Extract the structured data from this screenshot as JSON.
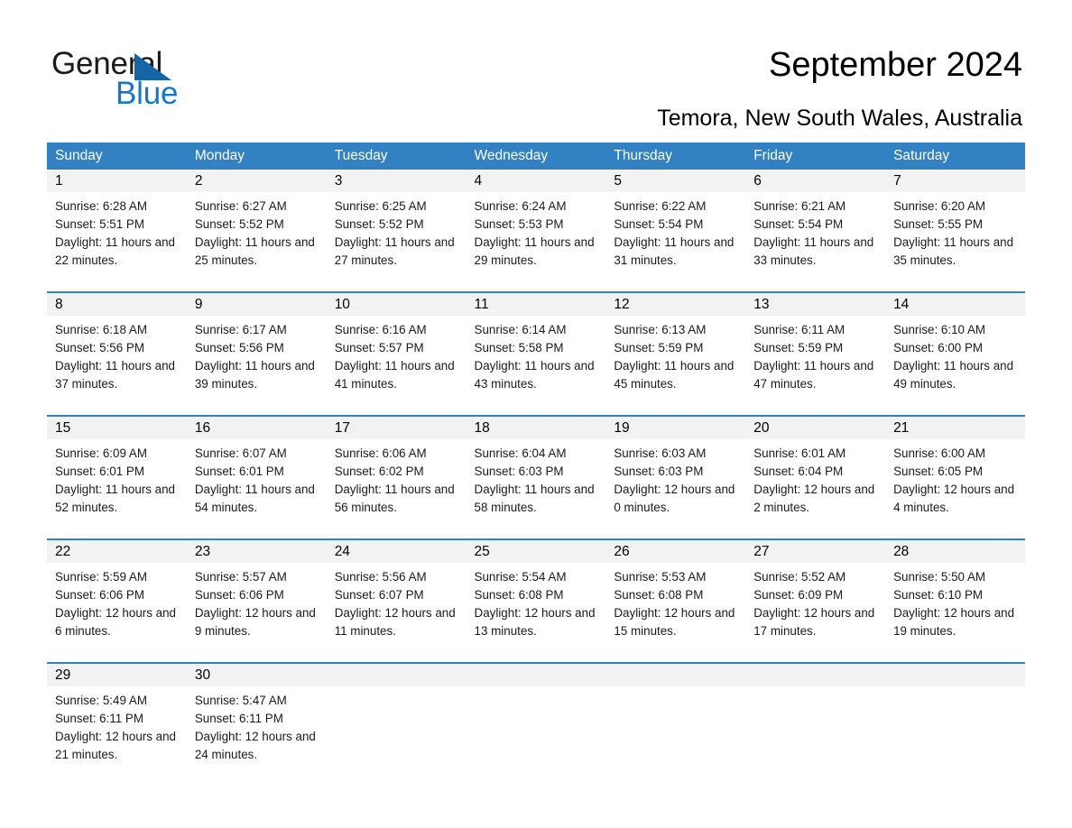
{
  "brand": {
    "name_part1": "General",
    "name_part2": "Blue",
    "triangle_color": "#1565a8",
    "blue_color": "#1577cc"
  },
  "header": {
    "title": "September 2024",
    "location": "Temora, New South Wales, Australia"
  },
  "calendar": {
    "accent_color": "#3281c3",
    "daynum_band_color": "#f2f2f2",
    "weekday_headers": [
      "Sunday",
      "Monday",
      "Tuesday",
      "Wednesday",
      "Thursday",
      "Friday",
      "Saturday"
    ],
    "weeks": [
      [
        {
          "day": "1",
          "sunrise": "Sunrise: 6:28 AM",
          "sunset": "Sunset: 5:51 PM",
          "daylight": "Daylight: 11 hours and 22 minutes."
        },
        {
          "day": "2",
          "sunrise": "Sunrise: 6:27 AM",
          "sunset": "Sunset: 5:52 PM",
          "daylight": "Daylight: 11 hours and 25 minutes."
        },
        {
          "day": "3",
          "sunrise": "Sunrise: 6:25 AM",
          "sunset": "Sunset: 5:52 PM",
          "daylight": "Daylight: 11 hours and 27 minutes."
        },
        {
          "day": "4",
          "sunrise": "Sunrise: 6:24 AM",
          "sunset": "Sunset: 5:53 PM",
          "daylight": "Daylight: 11 hours and 29 minutes."
        },
        {
          "day": "5",
          "sunrise": "Sunrise: 6:22 AM",
          "sunset": "Sunset: 5:54 PM",
          "daylight": "Daylight: 11 hours and 31 minutes."
        },
        {
          "day": "6",
          "sunrise": "Sunrise: 6:21 AM",
          "sunset": "Sunset: 5:54 PM",
          "daylight": "Daylight: 11 hours and 33 minutes."
        },
        {
          "day": "7",
          "sunrise": "Sunrise: 6:20 AM",
          "sunset": "Sunset: 5:55 PM",
          "daylight": "Daylight: 11 hours and 35 minutes."
        }
      ],
      [
        {
          "day": "8",
          "sunrise": "Sunrise: 6:18 AM",
          "sunset": "Sunset: 5:56 PM",
          "daylight": "Daylight: 11 hours and 37 minutes."
        },
        {
          "day": "9",
          "sunrise": "Sunrise: 6:17 AM",
          "sunset": "Sunset: 5:56 PM",
          "daylight": "Daylight: 11 hours and 39 minutes."
        },
        {
          "day": "10",
          "sunrise": "Sunrise: 6:16 AM",
          "sunset": "Sunset: 5:57 PM",
          "daylight": "Daylight: 11 hours and 41 minutes."
        },
        {
          "day": "11",
          "sunrise": "Sunrise: 6:14 AM",
          "sunset": "Sunset: 5:58 PM",
          "daylight": "Daylight: 11 hours and 43 minutes."
        },
        {
          "day": "12",
          "sunrise": "Sunrise: 6:13 AM",
          "sunset": "Sunset: 5:59 PM",
          "daylight": "Daylight: 11 hours and 45 minutes."
        },
        {
          "day": "13",
          "sunrise": "Sunrise: 6:11 AM",
          "sunset": "Sunset: 5:59 PM",
          "daylight": "Daylight: 11 hours and 47 minutes."
        },
        {
          "day": "14",
          "sunrise": "Sunrise: 6:10 AM",
          "sunset": "Sunset: 6:00 PM",
          "daylight": "Daylight: 11 hours and 49 minutes."
        }
      ],
      [
        {
          "day": "15",
          "sunrise": "Sunrise: 6:09 AM",
          "sunset": "Sunset: 6:01 PM",
          "daylight": "Daylight: 11 hours and 52 minutes."
        },
        {
          "day": "16",
          "sunrise": "Sunrise: 6:07 AM",
          "sunset": "Sunset: 6:01 PM",
          "daylight": "Daylight: 11 hours and 54 minutes."
        },
        {
          "day": "17",
          "sunrise": "Sunrise: 6:06 AM",
          "sunset": "Sunset: 6:02 PM",
          "daylight": "Daylight: 11 hours and 56 minutes."
        },
        {
          "day": "18",
          "sunrise": "Sunrise: 6:04 AM",
          "sunset": "Sunset: 6:03 PM",
          "daylight": "Daylight: 11 hours and 58 minutes."
        },
        {
          "day": "19",
          "sunrise": "Sunrise: 6:03 AM",
          "sunset": "Sunset: 6:03 PM",
          "daylight": "Daylight: 12 hours and 0 minutes."
        },
        {
          "day": "20",
          "sunrise": "Sunrise: 6:01 AM",
          "sunset": "Sunset: 6:04 PM",
          "daylight": "Daylight: 12 hours and 2 minutes."
        },
        {
          "day": "21",
          "sunrise": "Sunrise: 6:00 AM",
          "sunset": "Sunset: 6:05 PM",
          "daylight": "Daylight: 12 hours and 4 minutes."
        }
      ],
      [
        {
          "day": "22",
          "sunrise": "Sunrise: 5:59 AM",
          "sunset": "Sunset: 6:06 PM",
          "daylight": "Daylight: 12 hours and 6 minutes."
        },
        {
          "day": "23",
          "sunrise": "Sunrise: 5:57 AM",
          "sunset": "Sunset: 6:06 PM",
          "daylight": "Daylight: 12 hours and 9 minutes."
        },
        {
          "day": "24",
          "sunrise": "Sunrise: 5:56 AM",
          "sunset": "Sunset: 6:07 PM",
          "daylight": "Daylight: 12 hours and 11 minutes."
        },
        {
          "day": "25",
          "sunrise": "Sunrise: 5:54 AM",
          "sunset": "Sunset: 6:08 PM",
          "daylight": "Daylight: 12 hours and 13 minutes."
        },
        {
          "day": "26",
          "sunrise": "Sunrise: 5:53 AM",
          "sunset": "Sunset: 6:08 PM",
          "daylight": "Daylight: 12 hours and 15 minutes."
        },
        {
          "day": "27",
          "sunrise": "Sunrise: 5:52 AM",
          "sunset": "Sunset: 6:09 PM",
          "daylight": "Daylight: 12 hours and 17 minutes."
        },
        {
          "day": "28",
          "sunrise": "Sunrise: 5:50 AM",
          "sunset": "Sunset: 6:10 PM",
          "daylight": "Daylight: 12 hours and 19 minutes."
        }
      ],
      [
        {
          "day": "29",
          "sunrise": "Sunrise: 5:49 AM",
          "sunset": "Sunset: 6:11 PM",
          "daylight": "Daylight: 12 hours and 21 minutes."
        },
        {
          "day": "30",
          "sunrise": "Sunrise: 5:47 AM",
          "sunset": "Sunset: 6:11 PM",
          "daylight": "Daylight: 12 hours and 24 minutes."
        },
        {
          "day": "",
          "sunrise": "",
          "sunset": "",
          "daylight": ""
        },
        {
          "day": "",
          "sunrise": "",
          "sunset": "",
          "daylight": ""
        },
        {
          "day": "",
          "sunrise": "",
          "sunset": "",
          "daylight": ""
        },
        {
          "day": "",
          "sunrise": "",
          "sunset": "",
          "daylight": ""
        },
        {
          "day": "",
          "sunrise": "",
          "sunset": "",
          "daylight": ""
        }
      ]
    ]
  }
}
